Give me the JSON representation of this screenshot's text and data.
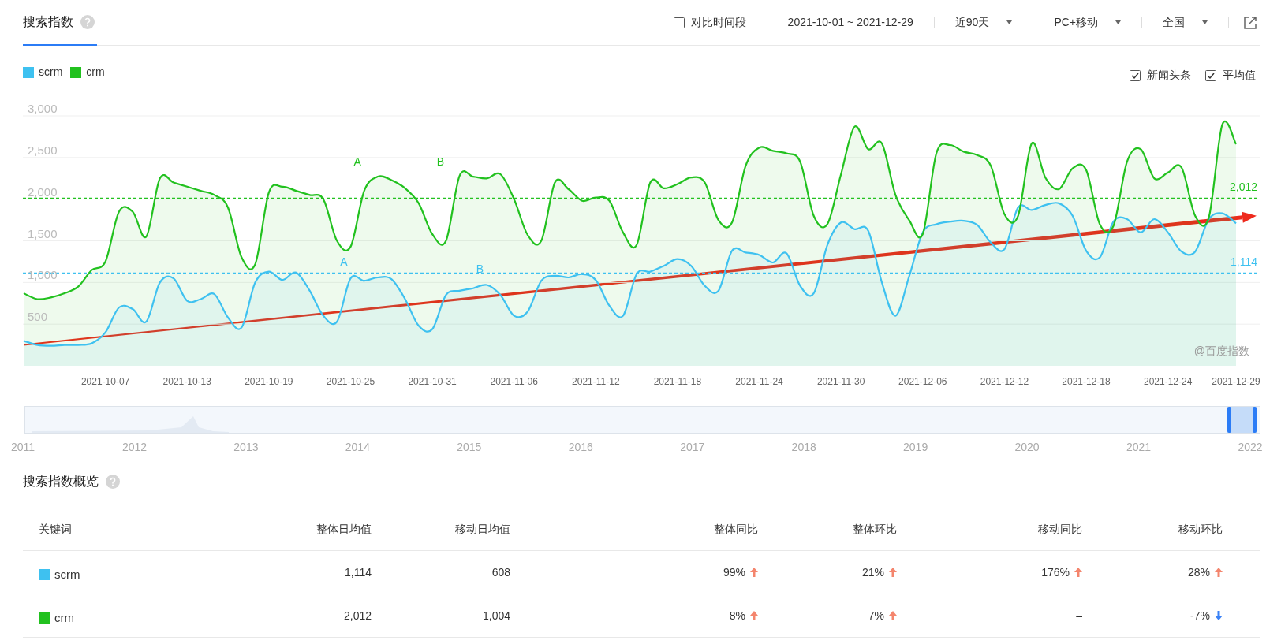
{
  "header": {
    "title": "搜索指数",
    "compare": {
      "label": "对比时间段",
      "checked": false
    },
    "date_range": "2021-10-01 ~ 2021-12-29",
    "dropdowns": [
      {
        "label": "近90天"
      },
      {
        "label": "PC+移动"
      },
      {
        "label": "全国"
      }
    ]
  },
  "options": [
    {
      "label": "新闻头条",
      "checked": true
    },
    {
      "label": "平均值",
      "checked": true
    }
  ],
  "chart": {
    "chart_data": {
      "type": "area",
      "x": [
        "2021-10-01",
        "2021-10-02",
        "2021-10-03",
        "2021-10-04",
        "2021-10-05",
        "2021-10-06",
        "2021-10-07",
        "2021-10-08",
        "2021-10-09",
        "2021-10-10",
        "2021-10-11",
        "2021-10-12",
        "2021-10-13",
        "2021-10-14",
        "2021-10-15",
        "2021-10-16",
        "2021-10-17",
        "2021-10-18",
        "2021-10-19",
        "2021-10-20",
        "2021-10-21",
        "2021-10-22",
        "2021-10-23",
        "2021-10-24",
        "2021-10-25",
        "2021-10-26",
        "2021-10-27",
        "2021-10-28",
        "2021-10-29",
        "2021-10-30",
        "2021-10-31",
        "2021-11-01",
        "2021-11-02",
        "2021-11-03",
        "2021-11-04",
        "2021-11-05",
        "2021-11-06",
        "2021-11-07",
        "2021-11-08",
        "2021-11-09",
        "2021-11-10",
        "2021-11-11",
        "2021-11-12",
        "2021-11-13",
        "2021-11-14",
        "2021-11-15",
        "2021-11-16",
        "2021-11-17",
        "2021-11-18",
        "2021-11-19",
        "2021-11-20",
        "2021-11-21",
        "2021-11-22",
        "2021-11-23",
        "2021-11-24",
        "2021-11-25",
        "2021-11-26",
        "2021-11-27",
        "2021-11-28",
        "2021-11-29",
        "2021-11-30",
        "2021-12-01",
        "2021-12-02",
        "2021-12-03",
        "2021-12-04",
        "2021-12-05",
        "2021-12-06",
        "2021-12-07",
        "2021-12-08",
        "2021-12-09",
        "2021-12-10",
        "2021-12-11",
        "2021-12-12",
        "2021-12-13",
        "2021-12-14",
        "2021-12-15",
        "2021-12-16",
        "2021-12-17",
        "2021-12-18",
        "2021-12-19",
        "2021-12-20",
        "2021-12-21",
        "2021-12-22",
        "2021-12-23",
        "2021-12-24",
        "2021-12-25",
        "2021-12-26",
        "2021-12-27",
        "2021-12-28",
        "2021-12-29"
      ],
      "xlim": [
        "2021-10-01",
        "2021-12-29"
      ],
      "series": [
        {
          "name": "scrm",
          "color": "#3ec1f0",
          "values": [
            300,
            250,
            240,
            250,
            250,
            270,
            400,
            700,
            680,
            530,
            1000,
            1050,
            780,
            800,
            860,
            580,
            460,
            1000,
            1130,
            1030,
            1120,
            900,
            600,
            530,
            1050,
            1020,
            1060,
            1040,
            800,
            480,
            440,
            850,
            900,
            930,
            970,
            850,
            600,
            650,
            1020,
            1080,
            1060,
            1100,
            1030,
            720,
            600,
            1100,
            1130,
            1200,
            1280,
            1200,
            960,
            900,
            1380,
            1360,
            1330,
            1240,
            1350,
            960,
            870,
            1450,
            1720,
            1640,
            1620,
            1000,
            600,
            1070,
            1600,
            1700,
            1730,
            1740,
            1690,
            1480,
            1400,
            1900,
            1870,
            1930,
            1950,
            1800,
            1380,
            1300,
            1730,
            1760,
            1600,
            1760,
            1600,
            1370,
            1370,
            1760,
            1830,
            1710
          ]
        },
        {
          "name": "crm",
          "color": "#22c11f",
          "values": [
            870,
            800,
            820,
            870,
            950,
            1150,
            1250,
            1850,
            1850,
            1550,
            2250,
            2200,
            2150,
            2100,
            2050,
            1900,
            1300,
            1220,
            2080,
            2150,
            2100,
            2050,
            2000,
            1500,
            1430,
            2100,
            2270,
            2230,
            2130,
            1950,
            1580,
            1500,
            2280,
            2270,
            2250,
            2300,
            2000,
            1570,
            1500,
            2200,
            2120,
            1980,
            2020,
            1980,
            1600,
            1450,
            2200,
            2130,
            2180,
            2260,
            2200,
            1750,
            1720,
            2400,
            2620,
            2580,
            2550,
            2450,
            1800,
            1700,
            2300,
            2870,
            2600,
            2670,
            2050,
            1750,
            1580,
            2550,
            2650,
            2570,
            2530,
            2400,
            1820,
            1800,
            2670,
            2260,
            2120,
            2370,
            2350,
            1700,
            1680,
            2450,
            2600,
            2250,
            2320,
            2380,
            1800,
            1780,
            2900,
            2660
          ]
        }
      ],
      "ylim": [
        0,
        3000
      ],
      "yticks": [
        {
          "value": 500,
          "label": "500"
        },
        {
          "value": 1000,
          "label": "1,000"
        },
        {
          "value": 1500,
          "label": "1,500"
        },
        {
          "value": 2000,
          "label": "2,000"
        },
        {
          "value": 2500,
          "label": "2,500"
        },
        {
          "value": 3000,
          "label": "3,000"
        }
      ],
      "xticks": [
        "2021-10-07",
        "2021-10-13",
        "2021-10-19",
        "2021-10-25",
        "2021-10-31",
        "2021-11-06",
        "2021-11-12",
        "2021-11-18",
        "2021-11-24",
        "2021-11-30",
        "2021-12-06",
        "2021-12-12",
        "2021-12-18",
        "2021-12-24",
        "2021-12-29"
      ],
      "grid": true,
      "ref_lines": [
        {
          "axis": "y",
          "value": 2012,
          "label": "2,012",
          "color": "#22c11f"
        },
        {
          "axis": "y",
          "value": 1114,
          "label": "1,114",
          "color": "#3ec1f0"
        }
      ],
      "annotations": [
        "A",
        "B",
        "A",
        "B"
      ]
    },
    "source_label": "@百度指数"
  },
  "timeline": {
    "years": [
      "2011",
      "2012",
      "2013",
      "2014",
      "2015",
      "2016",
      "2017",
      "2018",
      "2019",
      "2020",
      "2021",
      "2022"
    ]
  },
  "overview": {
    "title": "搜索指数概览",
    "columns": [
      "关键词",
      "整体日均值",
      "移动日均值",
      "整体同比",
      "整体环比",
      "移动同比",
      "移动环比"
    ],
    "rows": [
      {
        "color": "#3ec1f0",
        "cells": [
          {
            "text": "scrm"
          },
          {
            "text": "1,114"
          },
          {
            "text": "608"
          },
          {
            "text": "99%",
            "kind": "up"
          },
          {
            "text": "21%",
            "kind": "up"
          },
          {
            "text": "176%",
            "kind": "up"
          },
          {
            "text": "28%",
            "kind": "up"
          }
        ]
      },
      {
        "color": "#22c11f",
        "cells": [
          {
            "text": "crm"
          },
          {
            "text": "2,012"
          },
          {
            "text": "1,004"
          },
          {
            "text": "8%",
            "kind": "up"
          },
          {
            "text": "7%",
            "kind": "up"
          },
          {
            "text": "–"
          },
          {
            "text": "-7%",
            "kind": "down"
          }
        ]
      }
    ]
  }
}
